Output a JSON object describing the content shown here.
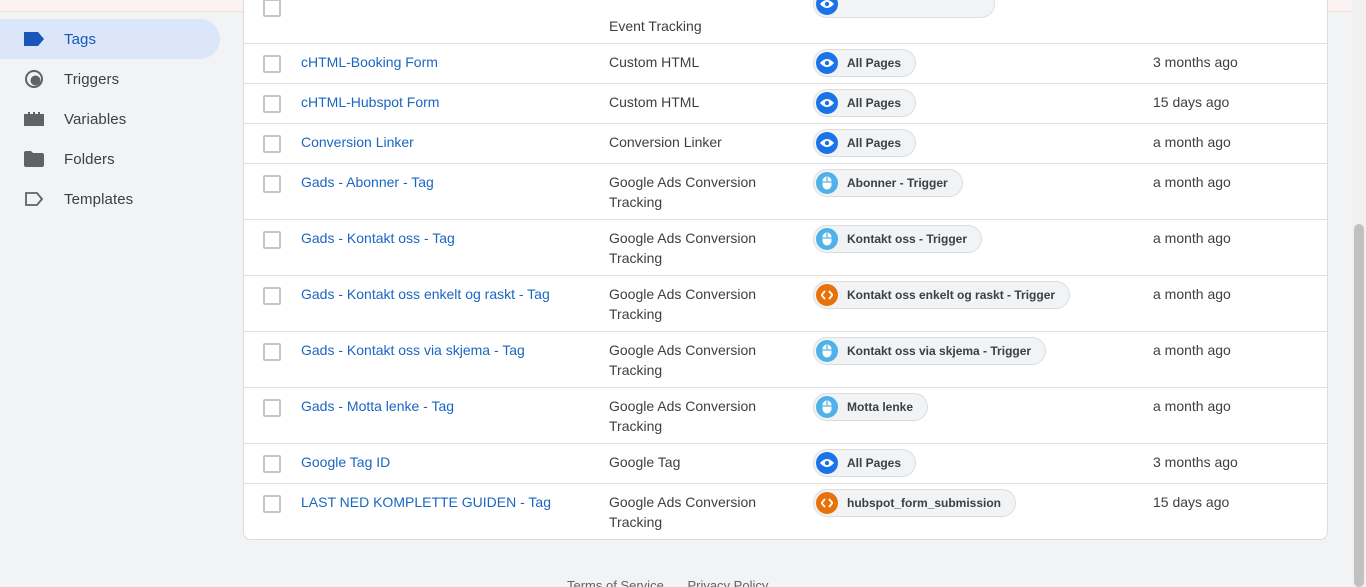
{
  "sidebar": {
    "items": [
      {
        "label": "Tags",
        "icon": "tag-icon",
        "active": true
      },
      {
        "label": "Triggers",
        "icon": "trigger-icon",
        "active": false
      },
      {
        "label": "Variables",
        "icon": "variables-icon",
        "active": false
      },
      {
        "label": "Folders",
        "icon": "folder-icon",
        "active": false
      },
      {
        "label": "Templates",
        "icon": "template-icon",
        "active": false
      }
    ]
  },
  "tags": {
    "rows": [
      {
        "name": "",
        "type": "Event Tracking",
        "trigger": "",
        "trigger_icon": "pageview-icon",
        "edited": ""
      },
      {
        "name": "cHTML-Booking Form",
        "type": "Custom HTML",
        "trigger": "All Pages",
        "trigger_icon": "pageview-icon",
        "edited": "3 months ago"
      },
      {
        "name": "cHTML-Hubspot Form",
        "type": "Custom HTML",
        "trigger": "All Pages",
        "trigger_icon": "pageview-icon",
        "edited": "15 days ago"
      },
      {
        "name": "Conversion Linker",
        "type": "Conversion Linker",
        "trigger": "All Pages",
        "trigger_icon": "pageview-icon",
        "edited": "a month ago"
      },
      {
        "name": "Gads - Abonner - Tag",
        "type": "Google Ads Conversion Tracking",
        "trigger": "Abonner - Trigger",
        "trigger_icon": "click-icon",
        "edited": "a month ago"
      },
      {
        "name": "Gads - Kontakt oss - Tag",
        "type": "Google Ads Conversion Tracking",
        "trigger": "Kontakt oss - Trigger",
        "trigger_icon": "click-icon",
        "edited": "a month ago"
      },
      {
        "name": "Gads - Kontakt oss enkelt og raskt - Tag",
        "type": "Google Ads Conversion Tracking",
        "trigger": "Kontakt oss enkelt og raskt - Trigger",
        "trigger_icon": "custom-event-icon",
        "edited": "a month ago"
      },
      {
        "name": "Gads - Kontakt oss via skjema - Tag",
        "type": "Google Ads Conversion Tracking",
        "trigger": "Kontakt oss via skjema - Trigger",
        "trigger_icon": "click-icon",
        "edited": "a month ago"
      },
      {
        "name": "Gads - Motta lenke - Tag",
        "type": "Google Ads Conversion Tracking",
        "trigger": "Motta lenke",
        "trigger_icon": "click-icon",
        "edited": "a month ago"
      },
      {
        "name": "Google Tag ID",
        "type": "Google Tag",
        "trigger": "All Pages",
        "trigger_icon": "pageview-icon",
        "edited": "3 months ago"
      },
      {
        "name": "LAST NED KOMPLETTE GUIDEN - Tag",
        "type": "Google Ads Conversion Tracking",
        "trigger": "hubspot_form_submission",
        "trigger_icon": "custom-event-icon",
        "edited": "15 days ago"
      }
    ]
  },
  "footer": {
    "terms": "Terms of Service",
    "privacy": "Privacy Policy"
  }
}
